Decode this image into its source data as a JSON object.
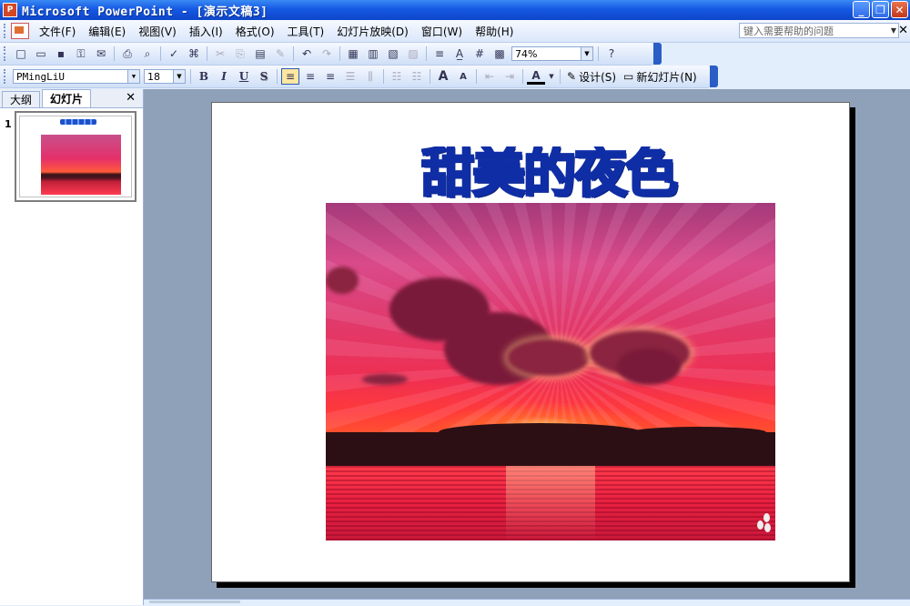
{
  "window": {
    "app_icon_glyph": "P",
    "title": "Microsoft PowerPoint - [演示文稿3]",
    "minimize_glyph": "_",
    "restore_glyph": "❐",
    "close_glyph": "✕"
  },
  "menubar": {
    "items": [
      "文件(F)",
      "编辑(E)",
      "视图(V)",
      "插入(I)",
      "格式(O)",
      "工具(T)",
      "幻灯片放映(D)",
      "窗口(W)",
      "帮助(H)"
    ],
    "help_placeholder": "键入需要帮助的问题",
    "doc_close_glyph": "✕"
  },
  "toolbar_standard": {
    "zoom": "74%",
    "icons": {
      "new": "□",
      "open": "▭",
      "save": "▪",
      "permission": "⚿",
      "email": "✉",
      "print": "⎙",
      "preview": "⌕",
      "spell": "✓",
      "research": "⌘",
      "cut": "✂",
      "copy": "⎘",
      "paste": "▤",
      "format_painter": "✎",
      "undo": "↶",
      "redo": "↷",
      "chart": "▦",
      "table": "▥",
      "tables_borders": "▧",
      "insert_picture": "▨",
      "expand_all": "≡",
      "show_formatting": "A̲",
      "grid": "#",
      "color_grayscale": "▩",
      "help": "?"
    }
  },
  "toolbar_formatting": {
    "font": "PMingLiU",
    "size": "18",
    "bold": "B",
    "italic": "I",
    "underline": "U",
    "shadow": "S",
    "increase_font": "A",
    "decrease_font": "A",
    "font_color": "A",
    "design_label": "设计(S)",
    "new_slide_label": "新幻灯片(N)",
    "align_icons": {
      "left": "≡",
      "center": "≡",
      "right": "≡",
      "distribute": "☰",
      "columns": "⫼",
      "numbering": "☷",
      "bullets": "☷",
      "decrease_indent": "⇤",
      "increase_indent": "⇥"
    }
  },
  "left_pane": {
    "tabs": [
      "大纲",
      "幻灯片"
    ],
    "close_glyph": "✕",
    "slide_number": "1"
  },
  "slide": {
    "title": "甜美的夜色"
  }
}
